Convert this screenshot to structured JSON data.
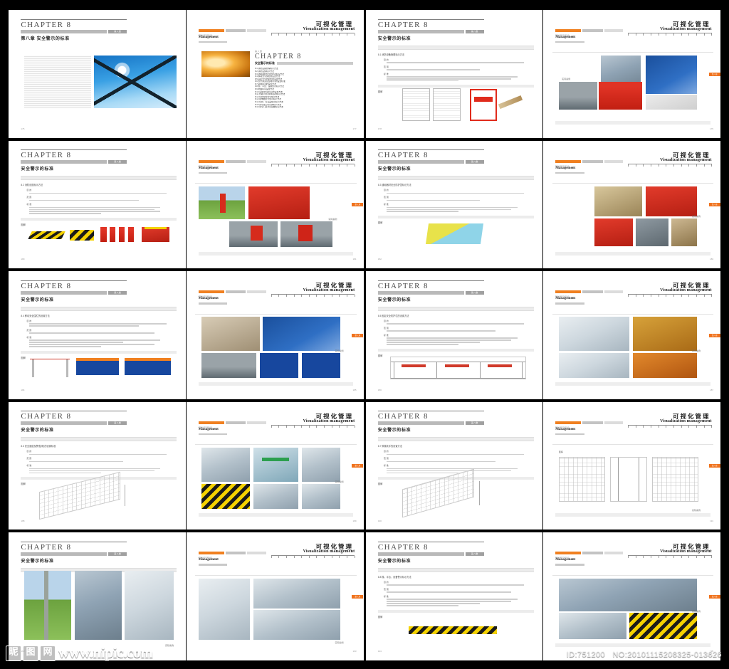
{
  "meta": {
    "background_color": "#000000",
    "accent_orange": "#f0731e",
    "grid_columns": 2,
    "grid_rows": 5
  },
  "watermark": {
    "logo_chars": [
      "昵",
      "图",
      "网"
    ],
    "url": "www.nipic.com"
  },
  "id_strip": {
    "full": "ID:751200 NO:20101115208325-013626",
    "id_label": "ID:751200",
    "no_label": "NO:20101115208325-013626"
  },
  "left_page": {
    "chapter_title": "CHAPTER 8",
    "chapter_tag": "第八章",
    "chapter_cn_full": "第八章 安全警示的标准",
    "chapter_cn_short": "安全警示的标准",
    "figure_label": "图解",
    "page_number": "176",
    "labels": {
      "purpose": "目 的",
      "scope": "范 围",
      "standard": "标 准"
    }
  },
  "right_page": {
    "brand_cn": "可视化管理",
    "brand_en": "Visualization management",
    "sub_en_small": "Visualization",
    "sub_en_big": "Management",
    "case_label": "实际案例",
    "tab_label": "第八章",
    "page_number": "177"
  },
  "spreads": [
    {
      "index": 1,
      "left": {
        "kind": "chapter-cover",
        "title": "CHAPTER 8",
        "tag": "第八章",
        "cn": "第八章 安全警示的标准",
        "page_number": "176"
      },
      "right": {
        "kind": "chapter-toc",
        "title": "CHAPTER 8",
        "subtitle": "安全警示的标准",
        "overline": "第八章",
        "page_number": "177",
        "toc": [
          "8.1 消防设备管理标示方法",
          "8.2 消防设施标示方法",
          "8.3 通用器材安全防护罩标识方法",
          "8.4 移动安全围栏的设置方法",
          "8.5 固定安全防护栏的设置方法",
          "8.6 安全通道及警戒(带)的设置标准",
          "8.7 斜梯扶手的设置方法",
          "8.8 梯、平台、设备警示标示方法",
          "8.9 地面标识设置方法",
          "8.10 设备(管)道标识的设置方法",
          "8.11 管路介质流向标识的标示方法",
          "8.12 危险部位安全警示方法",
          "8.13 配电箱安全警示标示方法",
          "8.14 危险、有毒品警示标示方法",
          "8.15 安全出口标识的标示方法",
          "8.16 安全门及紧急疏散标识方法"
        ]
      }
    },
    {
      "index": 2,
      "left": {
        "kind": "text-figure",
        "title": "CHAPTER 8",
        "tag": "第八章",
        "cn": "安全警示的标准",
        "section": "8.1 消防设备管理标示方法",
        "figure_label": "图解",
        "page_number": "178"
      },
      "right": {
        "kind": "photo-wall",
        "case_label": "实际案例",
        "tab_label": "第八章",
        "page_number": "179"
      }
    },
    {
      "index": 3,
      "left": {
        "kind": "text-figure",
        "title": "CHAPTER 8",
        "tag": "第八章",
        "cn": "安全警示的标准",
        "section": "8.2 消防设施标示方法",
        "figure_label": "图解",
        "page_number": "180"
      },
      "right": {
        "kind": "photo-wall",
        "case_label": "实际案例",
        "tab_label": "第八章",
        "page_number": "181"
      }
    },
    {
      "index": 4,
      "left": {
        "kind": "text-figure",
        "title": "CHAPTER 8",
        "tag": "第八章",
        "cn": "安全警示的标准",
        "section": "8.3 通用器材安全防护罩标识方法",
        "figure_label": "图解",
        "page_number": "182"
      },
      "right": {
        "kind": "photo-wall",
        "case_label": "实际案例",
        "tab_label": "第八章",
        "page_number": "183"
      }
    },
    {
      "index": 5,
      "left": {
        "kind": "text-figure",
        "title": "CHAPTER 8",
        "tag": "第八章",
        "cn": "安全警示的标准",
        "section": "8.4 移动安全围栏的设置方法",
        "figure_label": "图解",
        "page_number": "184"
      },
      "right": {
        "kind": "photo-wall",
        "case_label": "实际案例",
        "tab_label": "第八章",
        "page_number": "185"
      }
    },
    {
      "index": 6,
      "left": {
        "kind": "text-figure",
        "title": "CHAPTER 8",
        "tag": "第八章",
        "cn": "安全警示的标准",
        "section": "8.5 固定安全防护栏的设置方法",
        "figure_label": "图解",
        "page_number": "186"
      },
      "right": {
        "kind": "photo-wall",
        "case_label": "实际案例",
        "tab_label": "第八章",
        "page_number": "187"
      }
    },
    {
      "index": 7,
      "left": {
        "kind": "text-figure",
        "title": "CHAPTER 8",
        "tag": "第八章",
        "cn": "安全警示的标准",
        "section": "8.6 安全通道及警戒(带)的设置标准",
        "figure_label": "图解",
        "page_number": "188"
      },
      "right": {
        "kind": "photo-wall",
        "case_label": "实际案例",
        "tab_label": "第八章",
        "page_number": "189"
      }
    },
    {
      "index": 8,
      "left": {
        "kind": "text-figure",
        "title": "CHAPTER 8",
        "tag": "第八章",
        "cn": "安全警示的标准",
        "section": "8.7 斜梯扶手的设置方法",
        "figure_label": "图解",
        "page_number": "190"
      },
      "right": {
        "kind": "drawing-wall",
        "case_label": "实际案例",
        "tab_label": "第八章",
        "page_number": "191"
      }
    },
    {
      "index": 9,
      "left": {
        "kind": "photo-wall-left",
        "title": "CHAPTER 8",
        "tag": "第八章",
        "cn": "安全警示的标准",
        "case_label": "实际案例",
        "page_number": "192"
      },
      "right": {
        "kind": "photo-wall",
        "case_label": "实际案例",
        "tab_label": "第八章",
        "page_number": "193"
      }
    },
    {
      "index": 10,
      "left": {
        "kind": "text-figure",
        "title": "CHAPTER 8",
        "tag": "第八章",
        "cn": "安全警示的标准",
        "section": "8.8 梯、平台、设备警示标示方法",
        "figure_label": "图解",
        "page_number": "194"
      },
      "right": {
        "kind": "photo-wall",
        "case_label": "实际案例",
        "tab_label": "第八章",
        "page_number": "195"
      }
    }
  ]
}
